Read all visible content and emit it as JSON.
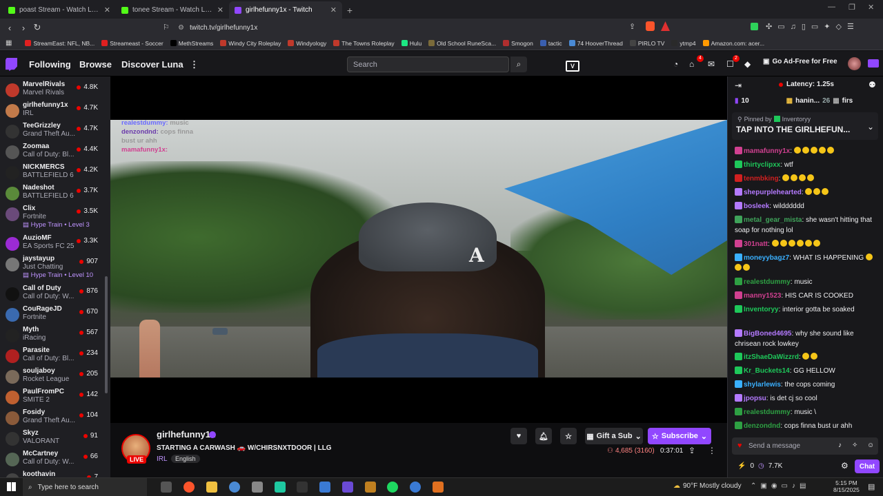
{
  "browser": {
    "tabs": [
      {
        "title": "poast Stream - Watch Live on Kick",
        "icon": "kick-icon",
        "color": "#53fc18"
      },
      {
        "title": "tonee Stream - Watch Live on Kick",
        "icon": "kick-icon",
        "color": "#53fc18"
      },
      {
        "title": "girlhefunny1x - Twitch",
        "icon": "twitch-icon",
        "color": "#9147ff"
      }
    ],
    "url": "twitch.tv/girlhefunny1x",
    "bookmarks": [
      {
        "label": "StreamEast: NFL, NB...",
        "color": "#e02020"
      },
      {
        "label": "Streameast - Soccer",
        "color": "#e02020"
      },
      {
        "label": "MethStreams",
        "color": "#000000"
      },
      {
        "label": "Windy City Roleplay",
        "color": "#c0392b"
      },
      {
        "label": "Windyology",
        "color": "#c0392b"
      },
      {
        "label": "The Towns Roleplay",
        "color": "#c0392b"
      },
      {
        "label": "Hulu",
        "color": "#1ce783"
      },
      {
        "label": "Old School RuneSca...",
        "color": "#7a6a3a"
      },
      {
        "label": "Smogon",
        "color": "#b02e2e"
      },
      {
        "label": "tactic",
        "color": "#3a5fb0"
      },
      {
        "label": "74 HooverThread",
        "color": "#4a8ad4"
      },
      {
        "label": "PIRLO TV",
        "color": "#444444"
      },
      {
        "label": "ytmp4",
        "color": "#2a2a2a"
      },
      {
        "label": "Amazon.com: acer...",
        "color": "#ff9900"
      }
    ]
  },
  "header": {
    "following": "Following",
    "browse": "Browse",
    "discover": "Discover Luna",
    "search_placeholder": "Search",
    "notif_count_1": "4",
    "notif_count_2": "2",
    "adfree": "Go Ad-Free for Free"
  },
  "sidebar": {
    "channels": [
      {
        "name": "MarvelRivals",
        "game": "Marvel Rivals",
        "viewers": "4.8K",
        "color": "#c0392b"
      },
      {
        "name": "girlhefunny1x",
        "game": "IRL",
        "viewers": "4.7K",
        "color": "#c27a4a"
      },
      {
        "name": "TeeGrizzley",
        "game": "Grand Theft Au...",
        "viewers": "4.7K",
        "color": "#333333"
      },
      {
        "name": "Zoomaa",
        "game": "Call of Duty: Bl...",
        "viewers": "4.4K",
        "color": "#555555"
      },
      {
        "name": "NICKMERCS",
        "game": "BATTLEFIELD 6",
        "viewers": "4.2K",
        "color": "#222222"
      },
      {
        "name": "Nadeshot",
        "game": "BATTLEFIELD 6",
        "viewers": "3.7K",
        "color": "#5a8a3a"
      },
      {
        "name": "Clix",
        "game": "Fortnite",
        "viewers": "3.5K",
        "color": "#6a4a7a",
        "hype": "Hype Train • Level 3"
      },
      {
        "name": "AuzioMF",
        "game": "EA Sports FC 25",
        "viewers": "3.3K",
        "color": "#9b2bd4"
      },
      {
        "name": "jaystayup",
        "game": "Just Chatting",
        "viewers": "907",
        "color": "#777777",
        "hype": "Hype Train • Level 10"
      },
      {
        "name": "Call of Duty",
        "game": "Call of Duty: W...",
        "viewers": "876",
        "color": "#111111"
      },
      {
        "name": "CouRageJD",
        "game": "Fortnite",
        "viewers": "670",
        "color": "#3a6ab0"
      },
      {
        "name": "Myth",
        "game": "iRacing",
        "viewers": "567",
        "color": "#222222"
      },
      {
        "name": "Parasite",
        "game": "Call of Duty: Bl...",
        "viewers": "234",
        "color": "#b02020"
      },
      {
        "name": "souljaboy",
        "game": "Rocket League",
        "viewers": "205",
        "color": "#7a6a5a"
      },
      {
        "name": "PaulFromPC",
        "game": "SMITE 2",
        "viewers": "142",
        "color": "#c06030"
      },
      {
        "name": "Fosidy",
        "game": "Grand Theft Au...",
        "viewers": "104",
        "color": "#8a5a3a"
      },
      {
        "name": "Skyz",
        "game": "VALORANT",
        "viewers": "91",
        "color": "#333333"
      },
      {
        "name": "McCartney",
        "game": "Call of Duty: W...",
        "viewers": "66",
        "color": "#556655"
      },
      {
        "name": "koothavin",
        "game": "",
        "viewers": "7",
        "color": "#444444"
      }
    ]
  },
  "overlay_chat": [
    {
      "user": "realestdummy:",
      "text": "music",
      "color": "#6a6aff"
    },
    {
      "user": "denzondnd:",
      "text": "cops finna",
      "color": "#6a3aaa"
    },
    {
      "user": "",
      "text": "bust ur ahh",
      "color": "#888888"
    },
    {
      "user": "mamafunny1x:",
      "text": "",
      "color": "#d04090"
    }
  ],
  "stream": {
    "streamer": "girlhefunny1x",
    "title": "STARTING A CARWASH 🚗 W/CHIRSNXTDOOR | LLG",
    "category": "IRL",
    "language": "English",
    "live": "LIVE",
    "viewers": "4,685 (3160)",
    "uptime": "0:37:01",
    "gift": "Gift a Sub",
    "subscribe": "Subscribe"
  },
  "chat": {
    "latency": "Latency: 1.25s",
    "leader_count_1": "10",
    "leader_name": "hanin...",
    "leader_count_2": "26",
    "leader_name_2": "firs",
    "pinned_by": "Pinned by",
    "pinned_user": "Inventoryy",
    "pinned_text": "TAP INTO THE GIRLHEFUN...",
    "messages": [
      {
        "user": "mamafunny1x",
        "text": "",
        "color": "#d04090",
        "emotes": 5
      },
      {
        "user": "thirtyclipxx",
        "text": "wtf",
        "color": "#1ec85a"
      },
      {
        "user": "tenmbking",
        "text": "",
        "color": "#d02020",
        "emotes": 4
      },
      {
        "user": "shepurplehearted",
        "text": "",
        "color": "#b47aff",
        "emotes": 3
      },
      {
        "user": "bosleek",
        "text": "wildddddd",
        "color": "#b47aff"
      },
      {
        "user": "metal_gear_mista",
        "text": "she wasn't hitting that soap for nothing lol",
        "color": "#3fa35a"
      },
      {
        "user": "301natt",
        "text": "",
        "color": "#d04090",
        "emotes": 6
      },
      {
        "user": "moneyybagz7",
        "text": "WHAT IS HAPPENING",
        "color": "#3ab0ff",
        "emotes": 3
      },
      {
        "user": "realestdummy",
        "text": "music",
        "color": "#2ea043"
      },
      {
        "user": "manny1523",
        "text": "HIS CAR IS COOKED",
        "color": "#d04090"
      },
      {
        "user": "Inventoryy",
        "text": "interior gotta be soaked",
        "color": "#1ec85a"
      },
      {
        "user": "BigBoned4695",
        "text": "why she sound like chrisean rock lowkey",
        "color": "#b47aff"
      },
      {
        "user": "itzShaeDaWizzrd",
        "text": "",
        "color": "#1ec85a",
        "emotes": 2
      },
      {
        "user": "Kr_Buckets14",
        "text": "GG HELLOW",
        "color": "#1ec85a"
      },
      {
        "user": "shylarlewis",
        "text": "the cops coming",
        "color": "#3ab0ff"
      },
      {
        "user": "jpopsu",
        "text": "is det cj so cool",
        "color": "#b47aff"
      },
      {
        "user": "realestdummy",
        "text": "music \\",
        "color": "#2ea043"
      },
      {
        "user": "denzondnd",
        "text": "cops finna bust ur ahh",
        "color": "#2ea043"
      }
    ],
    "input_placeholder": "Send a message",
    "points": "0",
    "bits": "7.7K",
    "chat_button": "Chat"
  },
  "taskbar": {
    "search_placeholder": "Type here to search",
    "weather": "90°F  Mostly cloudy",
    "time": "5:15 PM",
    "date": "8/15/2025"
  }
}
